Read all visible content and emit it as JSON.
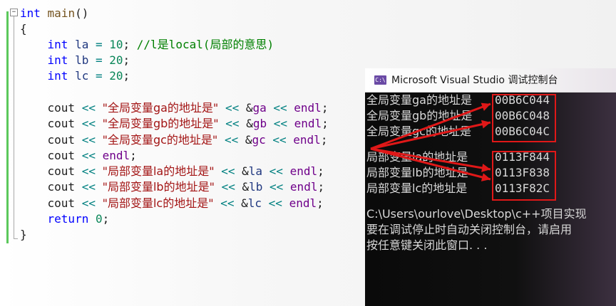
{
  "editor": {
    "fold_toggle": "−",
    "lines": [
      {
        "id": "l1",
        "tokens": [
          [
            "kw",
            "int"
          ],
          [
            "",
            " "
          ],
          [
            "fn",
            "main"
          ],
          [
            "",
            "()"
          ]
        ]
      },
      {
        "id": "l2",
        "tokens": [
          [
            "",
            "{"
          ]
        ]
      },
      {
        "id": "l3",
        "tokens": [
          [
            "",
            "    "
          ],
          [
            "kw",
            "int"
          ],
          [
            "",
            " "
          ],
          [
            "var",
            "la"
          ],
          [
            "op",
            " = "
          ],
          [
            "num",
            "10"
          ],
          [
            "",
            "; "
          ],
          [
            "cmt",
            "//l是local(局部的意思)"
          ]
        ]
      },
      {
        "id": "l4",
        "tokens": [
          [
            "",
            "    "
          ],
          [
            "kw",
            "int"
          ],
          [
            "",
            " "
          ],
          [
            "var",
            "lb"
          ],
          [
            "op",
            " = "
          ],
          [
            "num",
            "20"
          ],
          [
            "",
            ";"
          ]
        ]
      },
      {
        "id": "l5",
        "tokens": [
          [
            "",
            "    "
          ],
          [
            "kw",
            "int"
          ],
          [
            "",
            " "
          ],
          [
            "var",
            "lc"
          ],
          [
            "op",
            " = "
          ],
          [
            "num",
            "20"
          ],
          [
            "",
            ";"
          ]
        ]
      },
      {
        "id": "l6",
        "tokens": []
      },
      {
        "id": "l7",
        "tokens": [
          [
            "",
            "    cout "
          ],
          [
            "op",
            "<<"
          ],
          [
            "",
            " "
          ],
          [
            "str",
            "\"全局变量ga的地址是\""
          ],
          [
            "",
            " "
          ],
          [
            "op",
            "<<"
          ],
          [
            "",
            ""
          ],
          [
            "",
            ""
          ],
          [
            "",
            " &"
          ],
          [
            "nm",
            "ga"
          ],
          [
            "",
            " "
          ],
          [
            "op",
            "<<"
          ],
          [
            "",
            " "
          ],
          [
            "nm",
            "endl"
          ],
          [
            "",
            ";"
          ]
        ]
      },
      {
        "id": "l8",
        "tokens": [
          [
            "",
            "    cout "
          ],
          [
            "op",
            "<<"
          ],
          [
            "",
            " "
          ],
          [
            "str",
            "\"全局变量gb的地址是\""
          ],
          [
            "",
            " "
          ],
          [
            "op",
            "<<"
          ],
          [
            "",
            " &"
          ],
          [
            "nm",
            "gb"
          ],
          [
            "",
            " "
          ],
          [
            "op",
            "<<"
          ],
          [
            "",
            " "
          ],
          [
            "nm",
            "endl"
          ],
          [
            "",
            ";"
          ]
        ]
      },
      {
        "id": "l9",
        "tokens": [
          [
            "",
            "    cout "
          ],
          [
            "op",
            "<<"
          ],
          [
            "",
            " "
          ],
          [
            "str",
            "\"全局变量gc的地址是\""
          ],
          [
            "",
            " "
          ],
          [
            "op",
            "<<"
          ],
          [
            "",
            " &"
          ],
          [
            "nm",
            "gc"
          ],
          [
            "",
            " "
          ],
          [
            "op",
            "<<"
          ],
          [
            "",
            " "
          ],
          [
            "nm",
            "endl"
          ],
          [
            "",
            ";"
          ]
        ]
      },
      {
        "id": "l10",
        "tokens": [
          [
            "",
            "    cout "
          ],
          [
            "op",
            "<<"
          ],
          [
            "",
            " "
          ],
          [
            "nm",
            "endl"
          ],
          [
            "",
            ";"
          ]
        ]
      },
      {
        "id": "l11",
        "tokens": [
          [
            "",
            "    cout "
          ],
          [
            "op",
            "<<"
          ],
          [
            "",
            " "
          ],
          [
            "str",
            "\"局部变量la的地址是\""
          ],
          [
            "",
            " "
          ],
          [
            "op",
            "<<"
          ],
          [
            "",
            " &"
          ],
          [
            "var",
            "la"
          ],
          [
            "",
            " "
          ],
          [
            "op",
            "<<"
          ],
          [
            "",
            " "
          ],
          [
            "nm",
            "endl"
          ],
          [
            "",
            ";"
          ]
        ]
      },
      {
        "id": "l12",
        "tokens": [
          [
            "",
            "    cout "
          ],
          [
            "op",
            "<<"
          ],
          [
            "",
            " "
          ],
          [
            "str",
            "\"局部变量lb的地址是\""
          ],
          [
            "",
            " "
          ],
          [
            "op",
            "<<"
          ],
          [
            "",
            " &"
          ],
          [
            "var",
            "lb"
          ],
          [
            "",
            " "
          ],
          [
            "op",
            "<<"
          ],
          [
            "",
            " "
          ],
          [
            "nm",
            "endl"
          ],
          [
            "",
            ";"
          ]
        ]
      },
      {
        "id": "l13",
        "tokens": [
          [
            "",
            "    cout "
          ],
          [
            "op",
            "<<"
          ],
          [
            "",
            " "
          ],
          [
            "str",
            "\"局部变量lc的地址是\""
          ],
          [
            "",
            " "
          ],
          [
            "op",
            "<<"
          ],
          [
            "",
            " &"
          ],
          [
            "var",
            "lc"
          ],
          [
            "",
            " "
          ],
          [
            "op",
            "<<"
          ],
          [
            "",
            " "
          ],
          [
            "nm",
            "endl"
          ],
          [
            "",
            ";"
          ]
        ]
      },
      {
        "id": "l14",
        "tokens": [
          [
            "",
            "    "
          ],
          [
            "kw",
            "return"
          ],
          [
            "",
            " "
          ],
          [
            "num",
            "0"
          ],
          [
            "",
            ";"
          ]
        ]
      },
      {
        "id": "l15",
        "tokens": [
          [
            "",
            "}"
          ]
        ]
      }
    ]
  },
  "console": {
    "icon_text": "C:\\",
    "title": "Microsoft Visual Studio 调试控制台",
    "lines": [
      {
        "label": "全局变量ga的地址是",
        "addr": "00B6C044"
      },
      {
        "label": "全局变量gb的地址是",
        "addr": "00B6C048"
      },
      {
        "label": "全局变量gc的地址是",
        "addr": "00B6C04C"
      },
      {
        "label": "",
        "addr": ""
      },
      {
        "label": "局部变量la的地址是",
        "addr": "0113F844"
      },
      {
        "label": "局部变量lb的地址是",
        "addr": "0113F838"
      },
      {
        "label": "局部变量lc的地址是",
        "addr": "0113F82C"
      },
      {
        "label": "",
        "addr": ""
      },
      {
        "label": "C:\\Users\\ourlove\\Desktop\\c++项目实现",
        "addr": ""
      },
      {
        "label": "要在调试停止时自动关闭控制台，请启用",
        "addr": ""
      },
      {
        "label": "按任意键关闭此窗口. . .",
        "addr": ""
      }
    ]
  },
  "colors": {
    "highlight_box": "#e01818",
    "arrow": "#e01818"
  }
}
